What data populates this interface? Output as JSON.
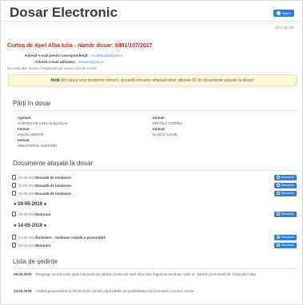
{
  "header": {
    "title": "Dosar Electronic",
    "logout_label": "Ieșire"
  },
  "ip_address": "10.3.49.252",
  "case": {
    "court_line": "Curtea de Apel Alba Iulia - număr dosar: 6491/107/2017",
    "correspondence_label": "Adresă e-mail pentru corespondență:",
    "correspondence_value": "ca-albaiulia@just.ro",
    "user_email_label": "Adresă e-mail utilizator:",
    "user_email_value": "intranet@just.ro",
    "no_other_cases": "Nu aveți alte dosare înregistrate pe acest cont de e-mail"
  },
  "notice": {
    "bold": "Notă",
    "text": "din cauza unor probleme tehnice, această versiune afișează doar ultimele 50 de documente atașate la dosar!"
  },
  "parties_section": {
    "title": "Părți în dosar",
    "left": [
      {
        "text": "Apelant",
        "role": true
      },
      {
        "text": "CURTEA DE APEL ALBA IULIA",
        "role": false
      },
      {
        "text": "Intimat",
        "role": true
      },
      {
        "text": "IANOȘ ADRIAN",
        "role": false
      },
      {
        "text": "Intimat",
        "role": true
      },
      {
        "text": "MINISTERUL JUSTIȚIEI",
        "role": false
      }
    ],
    "right": [
      {
        "text": "Intimat",
        "role": true
      },
      {
        "text": "FRĂȚILĂ CORINA",
        "role": false
      },
      {
        "text": "Intimat",
        "role": true
      },
      {
        "text": "NAȘCU CĂLIN",
        "role": false
      }
    ]
  },
  "documents_section": {
    "title": "Documente atașate la dosar",
    "download_label": "Descarcă",
    "groups": [
      {
        "heading": "",
        "docs": [
          {
            "date": "20-06-2019",
            "name": "Dovadă de înmânare"
          },
          {
            "date": "11-06-2019",
            "name": "Dovadă de înmânare"
          },
          {
            "date": "10-06-2019",
            "name": "Dovadă de înmânare"
          }
        ]
      },
      {
        "heading": "● 29-05-2019 ●",
        "docs": [
          {
            "date": "29-05-2019",
            "name": "Hotarare"
          }
        ]
      },
      {
        "heading": "● 14-05-2019 ●",
        "docs": [
          {
            "date": "14-05-2019",
            "name": "Încheiere - Amânare inițială a pronunțării"
          },
          {
            "date": "09-01-2019",
            "name": "Hotarare"
          }
        ]
      }
    ]
  },
  "sessions_section": {
    "title": "Lista de ședințe",
    "items": [
      {
        "date": "29.05.2019",
        "text": "Respinge ca nefondat apelul declarat de pârâta Curtea de Apel Alba Iulia împotriva sentinței civile nr. 1001/5 pronunțată de Tribunalul Alba."
      },
      {
        "date": "14.05.2019",
        "text": "Amână pronunțarea la 29.05.2019, pentru când părțile au posibilitatea să formuleze concluzii scrise."
      }
    ]
  }
}
